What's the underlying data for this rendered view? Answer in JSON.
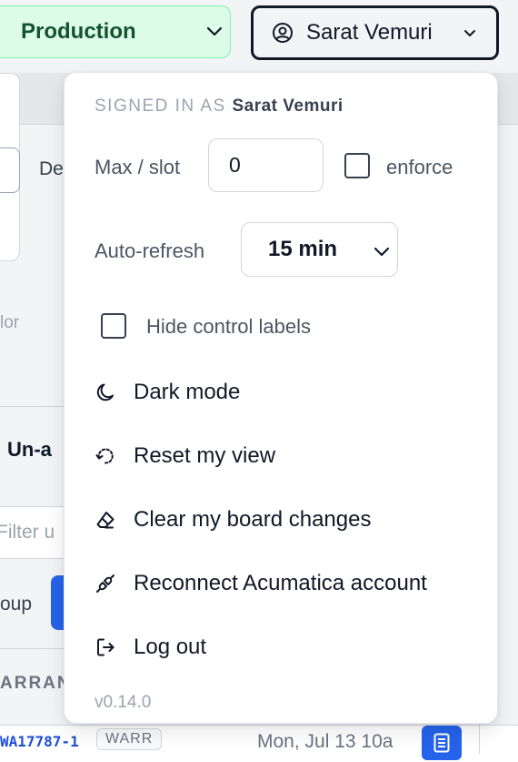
{
  "header": {
    "environment": "Production",
    "user_name": "Sarat Vemuri"
  },
  "background": {
    "fragment_de": "De",
    "fragment_lor": "lor",
    "fragment_unassigned": "Un-a",
    "fragment_filter": "Filter u",
    "fragment_group": "oup",
    "fragment_section": "ARRAN",
    "row": {
      "id": "WA17787-1",
      "tag": "WARR",
      "date": "Mon, Jul 13 10a"
    }
  },
  "menu": {
    "signed_in_prefix": "SIGNED IN AS",
    "signed_in_user": "Sarat Vemuri",
    "max_slot_label": "Max / slot",
    "max_slot_value": "0",
    "enforce_label": "enforce",
    "enforce_checked": false,
    "auto_refresh_label": "Auto-refresh",
    "auto_refresh_value": "15 min",
    "hide_labels_label": "Hide control labels",
    "hide_labels_checked": false,
    "items": [
      {
        "label": "Dark mode",
        "icon": "moon-icon"
      },
      {
        "label": "Reset my view",
        "icon": "reset-view-icon"
      },
      {
        "label": "Clear my board changes",
        "icon": "eraser-icon"
      },
      {
        "label": "Reconnect Acumatica account",
        "icon": "plug-icon"
      },
      {
        "label": "Log out",
        "icon": "logout-icon"
      }
    ],
    "version": "v0.14.0"
  },
  "colors": {
    "env_bg": "#dcfce7",
    "env_border": "#86efac",
    "accent_blue": "#2563eb",
    "muted_text": "#9ca3af"
  }
}
